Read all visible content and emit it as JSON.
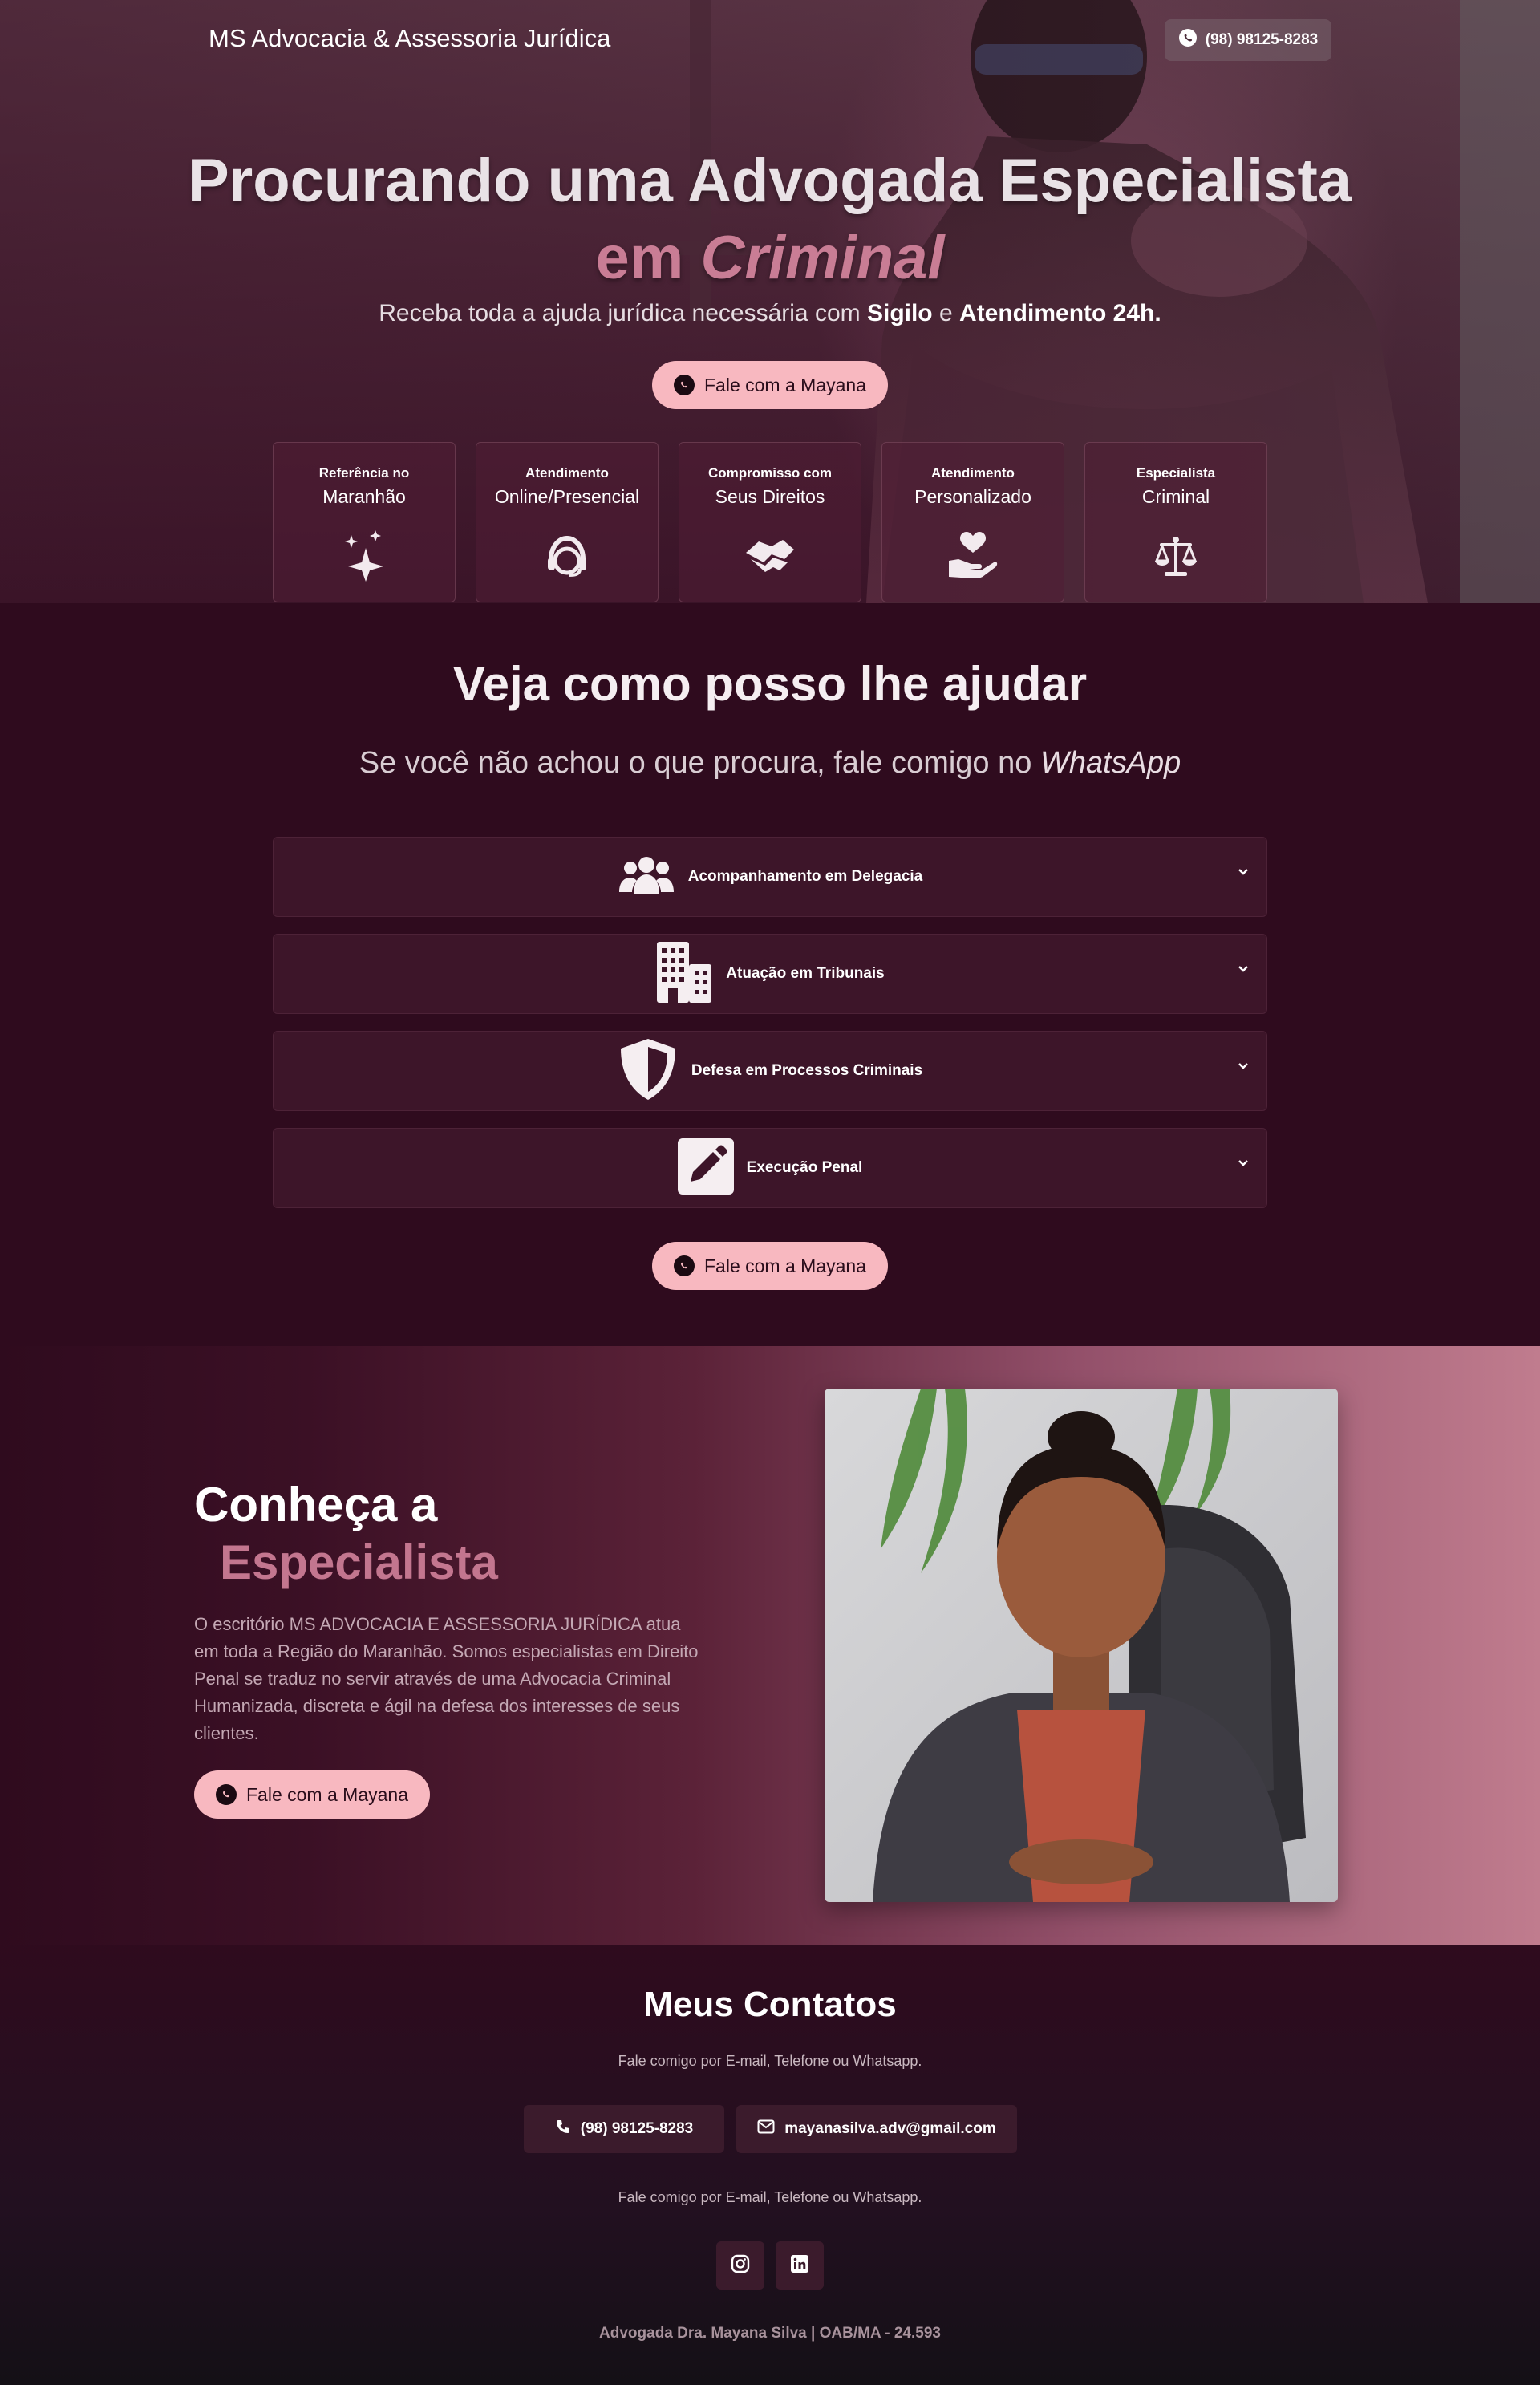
{
  "header": {
    "brand": "MS Advocacia & Assessoria Jurídica",
    "phone": "(98) 98125-8283"
  },
  "hero": {
    "title_line1": "Procurando uma Advogada Especialista",
    "title_em": "em",
    "title_area": "Criminal",
    "subtitle_prefix": "Receba toda a ajuda jurídica necessária com",
    "subtitle_b1": "Sigilo",
    "subtitle_mid": "e",
    "subtitle_b2": "Atendimento 24h.",
    "cta": "Fale com a Mayana"
  },
  "features": [
    {
      "small": "Referência no",
      "big": "Maranhão",
      "icon": "sparkles-icon"
    },
    {
      "small": "Atendimento",
      "big": "Online/Presencial",
      "icon": "headset-icon"
    },
    {
      "small": "Compromisso com",
      "big": "Seus Direitos",
      "icon": "handshake-icon"
    },
    {
      "small": "Atendimento",
      "big": "Personalizado",
      "icon": "hand-heart-icon"
    },
    {
      "small": "Especialista",
      "big": "Criminal",
      "icon": "scales-icon"
    }
  ],
  "services": {
    "title": "Veja como posso lhe ajudar",
    "subtitle_prefix": "Se você não achou o que procura, fale comigo no",
    "subtitle_em": "WhatsApp",
    "items": [
      {
        "label": "Acompanhamento em Delegacia",
        "icon": "users-icon"
      },
      {
        "label": "Atuação em Tribunais",
        "icon": "building-icon"
      },
      {
        "label": "Defesa em Processos Criminais",
        "icon": "shield-icon"
      },
      {
        "label": "Execução Penal",
        "icon": "pencil-icon"
      }
    ],
    "cta": "Fale com a Mayana"
  },
  "about": {
    "title_line1": "Conheça a",
    "title_line2": "Especialista",
    "text": "O escritório MS ADVOCACIA E ASSESSORIA JURÍDICA atua em toda a Região do Maranhão. Somos especialistas em Direito Penal se traduz no servir através de uma Advocacia Criminal Humanizada, discreta e ágil na defesa dos interesses de seus clientes.",
    "cta": "Fale com a Mayana"
  },
  "contacts": {
    "title": "Meus Contatos",
    "subtitle": "Fale comigo por E-mail, Telefone ou Whatsapp.",
    "phone": "(98) 98125-8283",
    "email": "mayanasilva.adv@gmail.com",
    "subtitle2": "Fale comigo por E-mail, Telefone ou Whatsapp.",
    "social": [
      "instagram-icon",
      "linkedin-icon"
    ],
    "footer": "Advogada Dra. Mayana Silva | OAB/MA - 24.593"
  },
  "colors": {
    "background": "#2f0b1e",
    "accent_pink": "#c97d95",
    "cta_bg": "#f8b8c0",
    "card_bg": "#3d1529"
  }
}
